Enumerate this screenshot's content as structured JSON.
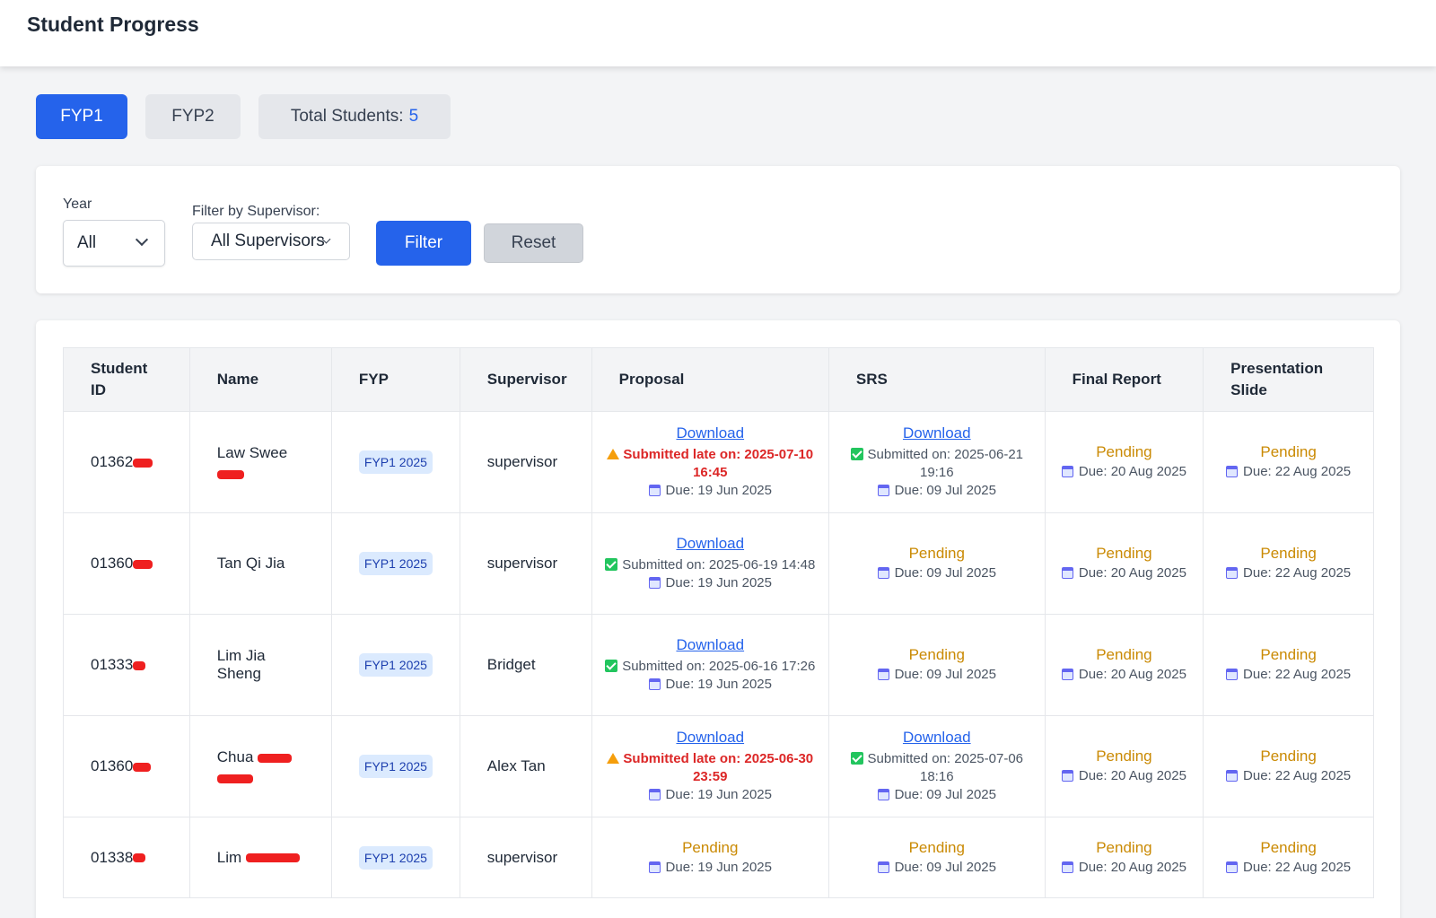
{
  "header": {
    "title": "Student Progress"
  },
  "tabs": {
    "fyp1": "FYP1",
    "fyp2": "FYP2",
    "total_label": "Total Students:",
    "total_count": "5"
  },
  "filters": {
    "year_label": "Year",
    "year_value": "All",
    "supervisor_label": "Filter by Supervisor:",
    "supervisor_value": "All Supervisors",
    "filter_button": "Filter",
    "reset_button": "Reset"
  },
  "table": {
    "headers": [
      "Student ID",
      "Name",
      "FYP",
      "Supervisor",
      "Proposal",
      "SRS",
      "Final Report",
      "Presentation Slide"
    ],
    "rows": [
      {
        "id": "01362",
        "name": "Law Swee",
        "fyp": "FYP1 2025",
        "supervisor": "supervisor",
        "proposal": {
          "download": "Download",
          "status": "Submitted late on: 2025-07-10 16:45",
          "late": true,
          "due": "Due: 19 Jun 2025"
        },
        "srs": {
          "download": "Download",
          "status": "Submitted on: 2025-06-21 19:16",
          "late": false,
          "due": "Due: 09 Jul 2025"
        },
        "final_report": {
          "pending": "Pending",
          "due": "Due: 20 Aug 2025"
        },
        "presentation": {
          "pending": "Pending",
          "due": "Due: 22 Aug 2025"
        }
      },
      {
        "id": "01360",
        "name": "Tan Qi Jia",
        "fyp": "FYP1 2025",
        "supervisor": "supervisor",
        "proposal": {
          "download": "Download",
          "status": "Submitted on: 2025-06-19 14:48",
          "late": false,
          "due": "Due: 19 Jun 2025"
        },
        "srs": {
          "pending": "Pending",
          "due": "Due: 09 Jul 2025"
        },
        "final_report": {
          "pending": "Pending",
          "due": "Due: 20 Aug 2025"
        },
        "presentation": {
          "pending": "Pending",
          "due": "Due: 22 Aug 2025"
        }
      },
      {
        "id": "01333",
        "name": "Lim Jia Sheng",
        "fyp": "FYP1 2025",
        "supervisor": "Bridget",
        "proposal": {
          "download": "Download",
          "status": "Submitted on: 2025-06-16 17:26",
          "late": false,
          "due": "Due: 19 Jun 2025"
        },
        "srs": {
          "pending": "Pending",
          "due": "Due: 09 Jul 2025"
        },
        "final_report": {
          "pending": "Pending",
          "due": "Due: 20 Aug 2025"
        },
        "presentation": {
          "pending": "Pending",
          "due": "Due: 22 Aug 2025"
        }
      },
      {
        "id": "01360",
        "name": "Chua",
        "fyp": "FYP1 2025",
        "supervisor": "Alex Tan",
        "proposal": {
          "download": "Download",
          "status": "Submitted late on: 2025-06-30 23:59",
          "late": true,
          "due": "Due: 19 Jun 2025"
        },
        "srs": {
          "download": "Download",
          "status": "Submitted on: 2025-07-06 18:16",
          "late": false,
          "due": "Due: 09 Jul 2025"
        },
        "final_report": {
          "pending": "Pending",
          "due": "Due: 20 Aug 2025"
        },
        "presentation": {
          "pending": "Pending",
          "due": "Due: 22 Aug 2025"
        }
      },
      {
        "id": "01338",
        "name": "Lim",
        "fyp": "FYP1 2025",
        "supervisor": "supervisor",
        "proposal": {
          "pending": "Pending",
          "due": "Due: 19 Jun 2025"
        },
        "srs": {
          "pending": "Pending",
          "due": "Due: 09 Jul 2025"
        },
        "final_report": {
          "pending": "Pending",
          "due": "Due: 20 Aug 2025"
        },
        "presentation": {
          "pending": "Pending",
          "due": "Due: 22 Aug 2025"
        }
      }
    ]
  }
}
